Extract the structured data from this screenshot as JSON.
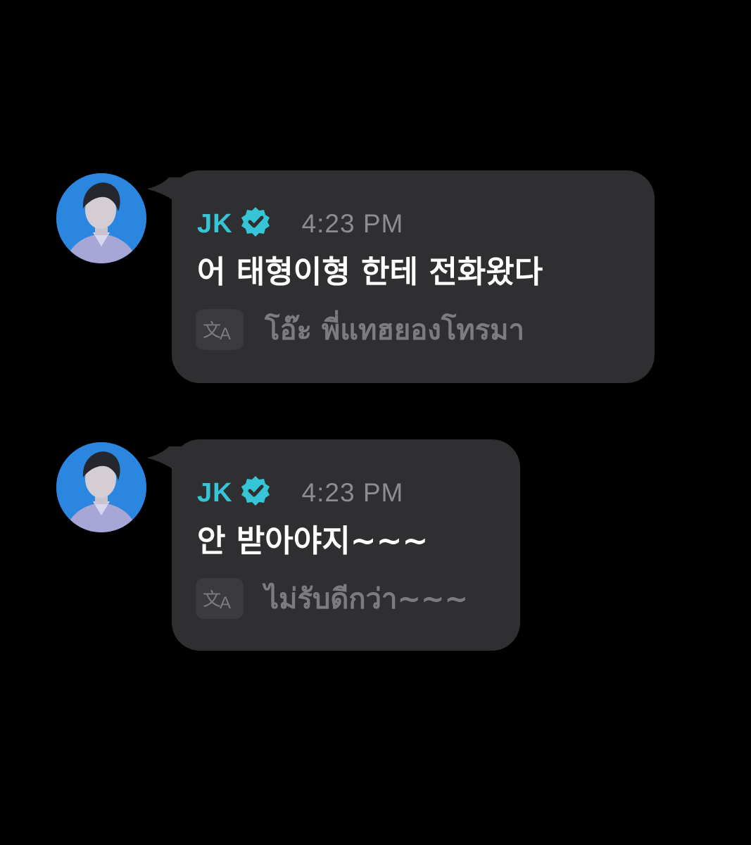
{
  "colors": {
    "background": "#000000",
    "bubble": "#2f2f31",
    "sender_name": "#35c5d6",
    "verified_badge": "#35c5d6",
    "timestamp": "#8d8d90",
    "message_text": "#ffffff",
    "translation_text": "#7c7c80",
    "avatar_bg": "#1f7ad6"
  },
  "messages": [
    {
      "avatar_icon": "profile-photo",
      "sender": "JK",
      "verified_icon": "verified-badge-icon",
      "time": "4:23 PM",
      "text": "어 태형이형 한테 전화왔다",
      "translate_icon": "translate-icon",
      "translation": "โอ๊ะ พี่แทฮยองโทรมา"
    },
    {
      "avatar_icon": "profile-photo",
      "sender": "JK",
      "verified_icon": "verified-badge-icon",
      "time": "4:23 PM",
      "text": "안 받아야지~~~",
      "translate_icon": "translate-icon",
      "translation": "ไม่รับดีกว่า~~~"
    }
  ]
}
